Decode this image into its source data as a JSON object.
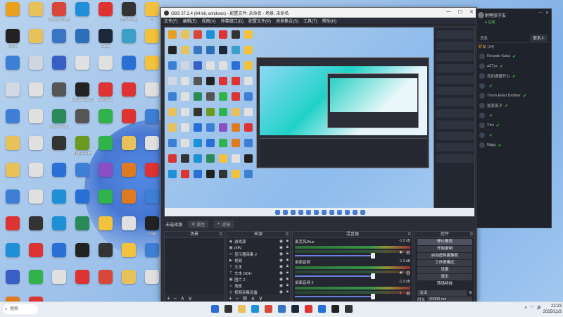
{
  "desktop": {
    "icons": [
      {
        "label": "",
        "icon": "qq-icon",
        "color": "#e9a020"
      },
      {
        "label": "",
        "icon": "folder-icon",
        "color": "#e8c15a"
      },
      {
        "label": "Google Chrome Book",
        "icon": "chrome-icon",
        "color": "#d9473a"
      },
      {
        "label": "",
        "icon": "edge-icon",
        "color": "#1f8fd6"
      },
      {
        "label": "",
        "icon": "game-icon",
        "color": "#d33"
      },
      {
        "label": "OBS Studio",
        "icon": "obs-icon",
        "color": "#333"
      },
      {
        "label": "YY",
        "icon": "yy-icon",
        "color": "#f2c23c"
      },
      {
        "label": "KOOK",
        "icon": "kook-icon",
        "color": "#222"
      },
      {
        "label": "",
        "icon": "folder-icon",
        "color": "#e8c15a"
      },
      {
        "label": "",
        "icon": "monitor-icon",
        "color": "#3a75c4"
      },
      {
        "label": "",
        "icon": "contact-icon",
        "color": "#2a6fb8"
      },
      {
        "label": "Steam",
        "icon": "steam-icon",
        "color": "#1b2838"
      },
      {
        "label": "",
        "icon": "app-icon",
        "color": "#3aa0c9"
      },
      {
        "label": "",
        "icon": "yy-icon",
        "color": "#f2c23c"
      },
      {
        "label": "",
        "icon": "folder-icon",
        "color": "#3e7fd6"
      },
      {
        "label": "",
        "icon": "doc-icon",
        "color": "#cfd6e1"
      },
      {
        "label": "",
        "icon": "gf-icon",
        "color": "#3a5fc4"
      },
      {
        "label": "",
        "icon": "file-icon",
        "color": "#e0e0e0"
      },
      {
        "label": "",
        "icon": "file-icon",
        "color": "#e0e0e0"
      },
      {
        "label": "",
        "icon": "tencent-icon",
        "color": "#2a6fd6"
      },
      {
        "label": "",
        "icon": "yy-icon",
        "color": "#f2c23c"
      },
      {
        "label": "",
        "icon": "recycle-icon",
        "color": "#d0d8e4"
      },
      {
        "label": "",
        "icon": "file-icon",
        "color": "#e0e0e0"
      },
      {
        "label": "",
        "icon": "app-icon",
        "color": "#555"
      },
      {
        "label": "Epic Games Launcher",
        "icon": "epic-icon",
        "color": "#222"
      },
      {
        "label": "WeGame",
        "icon": "wegame-icon",
        "color": "#d33"
      },
      {
        "label": "",
        "icon": "netease-icon",
        "color": "#d33"
      },
      {
        "label": "",
        "icon": "file-icon",
        "color": "#e0e0e0"
      },
      {
        "label": "",
        "icon": "app-icon",
        "color": "#3e7fd6"
      },
      {
        "label": "",
        "icon": "file-icon",
        "color": "#e0e0e0"
      },
      {
        "label": "Nature Cells",
        "icon": "app-icon",
        "color": "#2a8a5a"
      },
      {
        "label": "",
        "icon": "app-icon",
        "color": "#555"
      },
      {
        "label": "",
        "icon": "wechat-icon",
        "color": "#2fb34a"
      },
      {
        "label": "",
        "icon": "app-icon",
        "color": "#d33"
      },
      {
        "label": "",
        "icon": "app-icon",
        "color": "#3e7fd6"
      },
      {
        "label": "",
        "icon": "folder-icon",
        "color": "#e8c15a"
      },
      {
        "label": "",
        "icon": "file-icon",
        "color": "#e0e0e0"
      },
      {
        "label": "",
        "icon": "app-icon",
        "color": "#333"
      },
      {
        "label": "NVIDIA App",
        "icon": "nvidia-icon",
        "color": "#6a9a1f"
      },
      {
        "label": "",
        "icon": "wechat-icon",
        "color": "#2fb34a"
      },
      {
        "label": "",
        "icon": "folder-icon",
        "color": "#e8c15a"
      },
      {
        "label": "",
        "icon": "file-icon",
        "color": "#e0e0e0"
      },
      {
        "label": "",
        "icon": "folder-icon",
        "color": "#e8c15a"
      },
      {
        "label": "",
        "icon": "file-icon",
        "color": "#e0e0e0"
      },
      {
        "label": "",
        "icon": "app-icon",
        "color": "#2a6fd6"
      },
      {
        "label": "",
        "icon": "app-icon",
        "color": "#3e7fd6"
      },
      {
        "label": "",
        "icon": "app-icon",
        "color": "#8a4fc4"
      },
      {
        "label": "",
        "icon": "app-icon",
        "color": "#e07a20"
      },
      {
        "label": "",
        "icon": "app-icon",
        "color": "#d33"
      },
      {
        "label": "",
        "icon": "folder-icon",
        "color": "#3e7fd6"
      },
      {
        "label": "",
        "icon": "file-icon",
        "color": "#e0e0e0"
      },
      {
        "label": "",
        "icon": "app-icon",
        "color": "#1f8fd6"
      },
      {
        "label": "",
        "icon": "tencent-icon",
        "color": "#2a6fd6"
      },
      {
        "label": "",
        "icon": "app-icon",
        "color": "#2fb34a"
      },
      {
        "label": "",
        "icon": "game-icon",
        "color": "#e07a20"
      },
      {
        "label": "",
        "icon": "app-icon",
        "color": "#3e7fd6"
      },
      {
        "label": "",
        "icon": "app-icon",
        "color": "#d33"
      },
      {
        "label": "",
        "icon": "app-icon",
        "color": "#333"
      },
      {
        "label": "",
        "icon": "app-icon",
        "color": "#1f8fd6"
      },
      {
        "label": "",
        "icon": "app-icon",
        "color": "#2a8a5a"
      },
      {
        "label": "",
        "icon": "app-icon",
        "color": "#f2c23c"
      },
      {
        "label": "",
        "icon": "app-icon",
        "color": "#e0e0e0"
      },
      {
        "label": "Zepp",
        "icon": "zepp-icon",
        "color": "#222"
      },
      {
        "label": "",
        "icon": "edge-icon",
        "color": "#1f8fd6"
      },
      {
        "label": "",
        "icon": "app-icon",
        "color": "#d33"
      },
      {
        "label": "",
        "icon": "app-icon",
        "color": "#2a6fd6"
      },
      {
        "label": "",
        "icon": "app-icon",
        "color": "#222"
      },
      {
        "label": "",
        "icon": "app-icon",
        "color": "#333"
      },
      {
        "label": "",
        "icon": "app-icon",
        "color": "#f2c23c"
      },
      {
        "label": "",
        "icon": "app-icon",
        "color": "#3e7fd6"
      },
      {
        "label": "",
        "icon": "app-icon",
        "color": "#3a5fc4"
      },
      {
        "label": "",
        "icon": "app-icon",
        "color": "#2fb34a"
      },
      {
        "label": "",
        "icon": "file-icon",
        "color": "#e0e0e0"
      },
      {
        "label": "",
        "icon": "app-icon",
        "color": "#d33"
      },
      {
        "label": "",
        "icon": "app-icon",
        "color": "#d9473a"
      },
      {
        "label": "",
        "icon": "folder-icon",
        "color": "#e8c15a"
      },
      {
        "label": "",
        "icon": "file-icon",
        "color": "#e0e0e0"
      },
      {
        "label": "",
        "icon": "app-icon",
        "color": "#e07a20"
      },
      {
        "label": "",
        "icon": "app-icon",
        "color": "#d33"
      }
    ]
  },
  "obs": {
    "title": "OBS 27.2.4 (64-bit, windows) - 配置文件: 未命名 - 场景: 未命名",
    "menu": [
      "文件(F)",
      "编辑(E)",
      "视图(V)",
      "停靠窗口(D)",
      "配置文件(P)",
      "场景集合(S)",
      "工具(T)",
      "帮助(H)"
    ],
    "scene_bar": {
      "label": "未选择源",
      "props": "属性",
      "filters": "滤镜"
    },
    "scenes": {
      "title": "场景"
    },
    "sources": {
      "title": "来源",
      "items": [
        {
          "name": "游戏源",
          "icon": "game-source-icon"
        },
        {
          "name": "pdkj",
          "icon": "image-icon"
        },
        {
          "name": "显示器采集 2",
          "icon": "monitor-icon"
        },
        {
          "name": "视频",
          "icon": "media-icon"
        },
        {
          "name": "文本",
          "icon": "text-icon"
        },
        {
          "name": "文本 GDI+",
          "icon": "text-icon"
        },
        {
          "name": "图片 2",
          "icon": "image-icon"
        },
        {
          "name": "场景",
          "icon": "scene-icon"
        },
        {
          "name": "视频采集设备",
          "icon": "camera-icon"
        },
        {
          "name": "窗口采集",
          "icon": "window-icon"
        }
      ]
    },
    "mixer": {
      "title": "混音器",
      "channels": [
        {
          "name": "麦克风/Aux",
          "db": "-1.0 dB",
          "muted": false
        },
        {
          "name": "桌面音频",
          "db": "-1.0 dB",
          "muted": false
        },
        {
          "name": "桌面音频 2",
          "db": "-1.0 dB",
          "muted": true
        }
      ]
    },
    "controls": {
      "title": "控件",
      "buttons": [
        "停止推流",
        "开始录制",
        "启动虚拟摄像机",
        "工作室模式",
        "设置",
        "退出"
      ],
      "transitions_label": "转场特效",
      "mode": "淡出",
      "duration_label": "时长",
      "duration": "20000 ms"
    }
  },
  "chat": {
    "username": "射哩张字友",
    "status": "在线",
    "tabs": {
      "messages": "消息",
      "contacts": "联系人"
    },
    "section": "好友",
    "count": "(34)",
    "items": [
      "Ricardo Kaka",
      "aZ7ys",
      "您初遇魔开心",
      "",
      "Thom Elder Brother",
      "张笑笑子",
      "",
      "Ybo",
      "",
      "Nagy"
    ]
  },
  "taskbar": {
    "search_placeholder": "搜索",
    "clock_time": "22:23",
    "clock_date": "2025/11/3"
  }
}
